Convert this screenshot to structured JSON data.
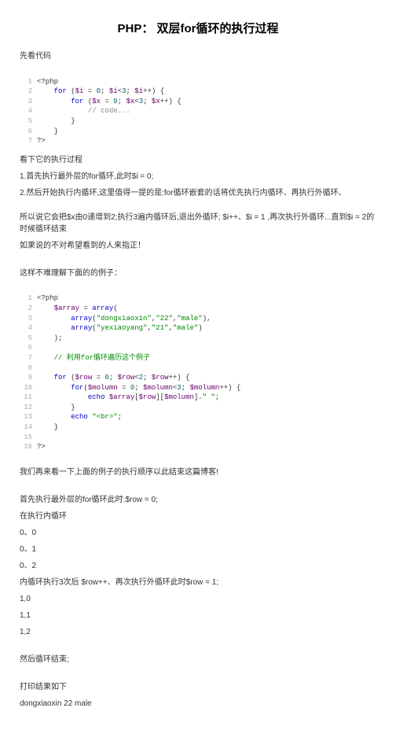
{
  "title": "PHP： 双层for循环的执行过程",
  "intro": "先看代码",
  "code1": {
    "l1": {
      "n": "1",
      "t": "<?php"
    },
    "l2": {
      "n": "2",
      "kw1": "for",
      "t1": " (",
      "v1": "$i",
      "t2": " = ",
      "n1": "0",
      "t3": "; ",
      "v2": "$i",
      "t4": "<",
      "n2": "3",
      "t5": "; ",
      "v3": "$i",
      "t6": "++) {"
    },
    "l3": {
      "n": "3",
      "kw1": "for",
      "t1": " (",
      "v1": "$x",
      "t2": " = ",
      "n1": "0",
      "t3": "; ",
      "v2": "$x",
      "t4": "<",
      "n2": "3",
      "t5": "; ",
      "v3": "$x",
      "t6": "++) {"
    },
    "l4": {
      "n": "4",
      "c": "// code..."
    },
    "l5": {
      "n": "5",
      "t": "}"
    },
    "l6": {
      "n": "6",
      "t": "}"
    },
    "l7": {
      "n": "7",
      "t": "?>"
    }
  },
  "p1": "看下它的执行过程",
  "p2": "1.首先执行最外层的for循环,此时$i = 0;",
  "p3": "2.然后开始执行内循环,这里值得一提的是:for循环嵌套的话将优先执行内循环、再执行外循环、",
  "p4": "所以说它会把$x由0递增到2;执行3遍内循环后,退出外循环; $i++、$i = 1 ,再次执行外循环...直到$i = 2的时候循环结束",
  "p5": "如果说的不对希望看到的人来指正！",
  "p6": "这样不难理解下面的的例子：",
  "code2": {
    "l1": {
      "n": "1",
      "t": "<?php"
    },
    "l2": {
      "n": "2",
      "v1": "$array",
      "t1": " = ",
      "kw1": "array",
      "t2": "("
    },
    "l3": {
      "n": "3",
      "kw1": "array",
      "t1": "(",
      "s1": "\"dongxiaoxin\"",
      "t2": ",",
      "s2": "\"22\"",
      "t3": ",",
      "s3": "\"male\"",
      "t4": "),"
    },
    "l4": {
      "n": "4",
      "kw1": "array",
      "t1": "(",
      "s1": "\"yexiaoyang\"",
      "t2": ",",
      "s2": "\"21\"",
      "t3": ",",
      "s3": "\"male\"",
      "t4": ")"
    },
    "l5": {
      "n": "5",
      "t": ");"
    },
    "l6": {
      "n": "6",
      "t": ""
    },
    "l7": {
      "n": "7",
      "c": "// 利用for循环遍历这个例子"
    },
    "l8": {
      "n": "8",
      "t": ""
    },
    "l9": {
      "n": "9",
      "kw1": "for",
      "t1": " (",
      "v1": "$row",
      "t2": " = ",
      "n1": "0",
      "t3": "; ",
      "v2": "$row",
      "t4": "<",
      "n2": "2",
      "t5": "; ",
      "v3": "$row",
      "t6": "++) {"
    },
    "l10": {
      "n": "10",
      "kw1": "for",
      "t1": "(",
      "v1": "$molumn",
      "t2": " = ",
      "n1": "0",
      "t3": "; ",
      "v2": "$molumn",
      "t4": "<",
      "n2": "3",
      "t5": "; ",
      "v3": "$molumn",
      "t6": "++) {"
    },
    "l11": {
      "n": "11",
      "kw1": "echo",
      "t1": " ",
      "v1": "$array",
      "t2": "[",
      "v2": "$row",
      "t3": "][",
      "v3": "$molumn",
      "t4": "].",
      "s1": "\" \"",
      "t5": ";"
    },
    "l12": {
      "n": "12",
      "t": "}"
    },
    "l13": {
      "n": "13",
      "kw1": "echo",
      "t1": " ",
      "s1": "\"<br>\"",
      "t2": ";"
    },
    "l14": {
      "n": "14",
      "t": "}"
    },
    "l15": {
      "n": "15",
      "t": ""
    },
    "l16": {
      "n": "16",
      "t": "?>"
    }
  },
  "p7": "我们再来看一下上面的例子的执行顺序以此结束这篇博客!",
  "p8": "首先执行最外层的for循环此时:$row = 0;",
  "p9": "在执行内循环",
  "p10": "0、0",
  "p11": "0、1",
  "p12": "0、2",
  "p13": "内循环执行3次后 $row++、再次执行外循环此时$row = 1;",
  "p14": "1,0",
  "p15": "1,1",
  "p16": "1,2",
  "p17": "然后循环结束;",
  "p18": "打印结果如下",
  "p19": "dongxiaoxin 22 male"
}
